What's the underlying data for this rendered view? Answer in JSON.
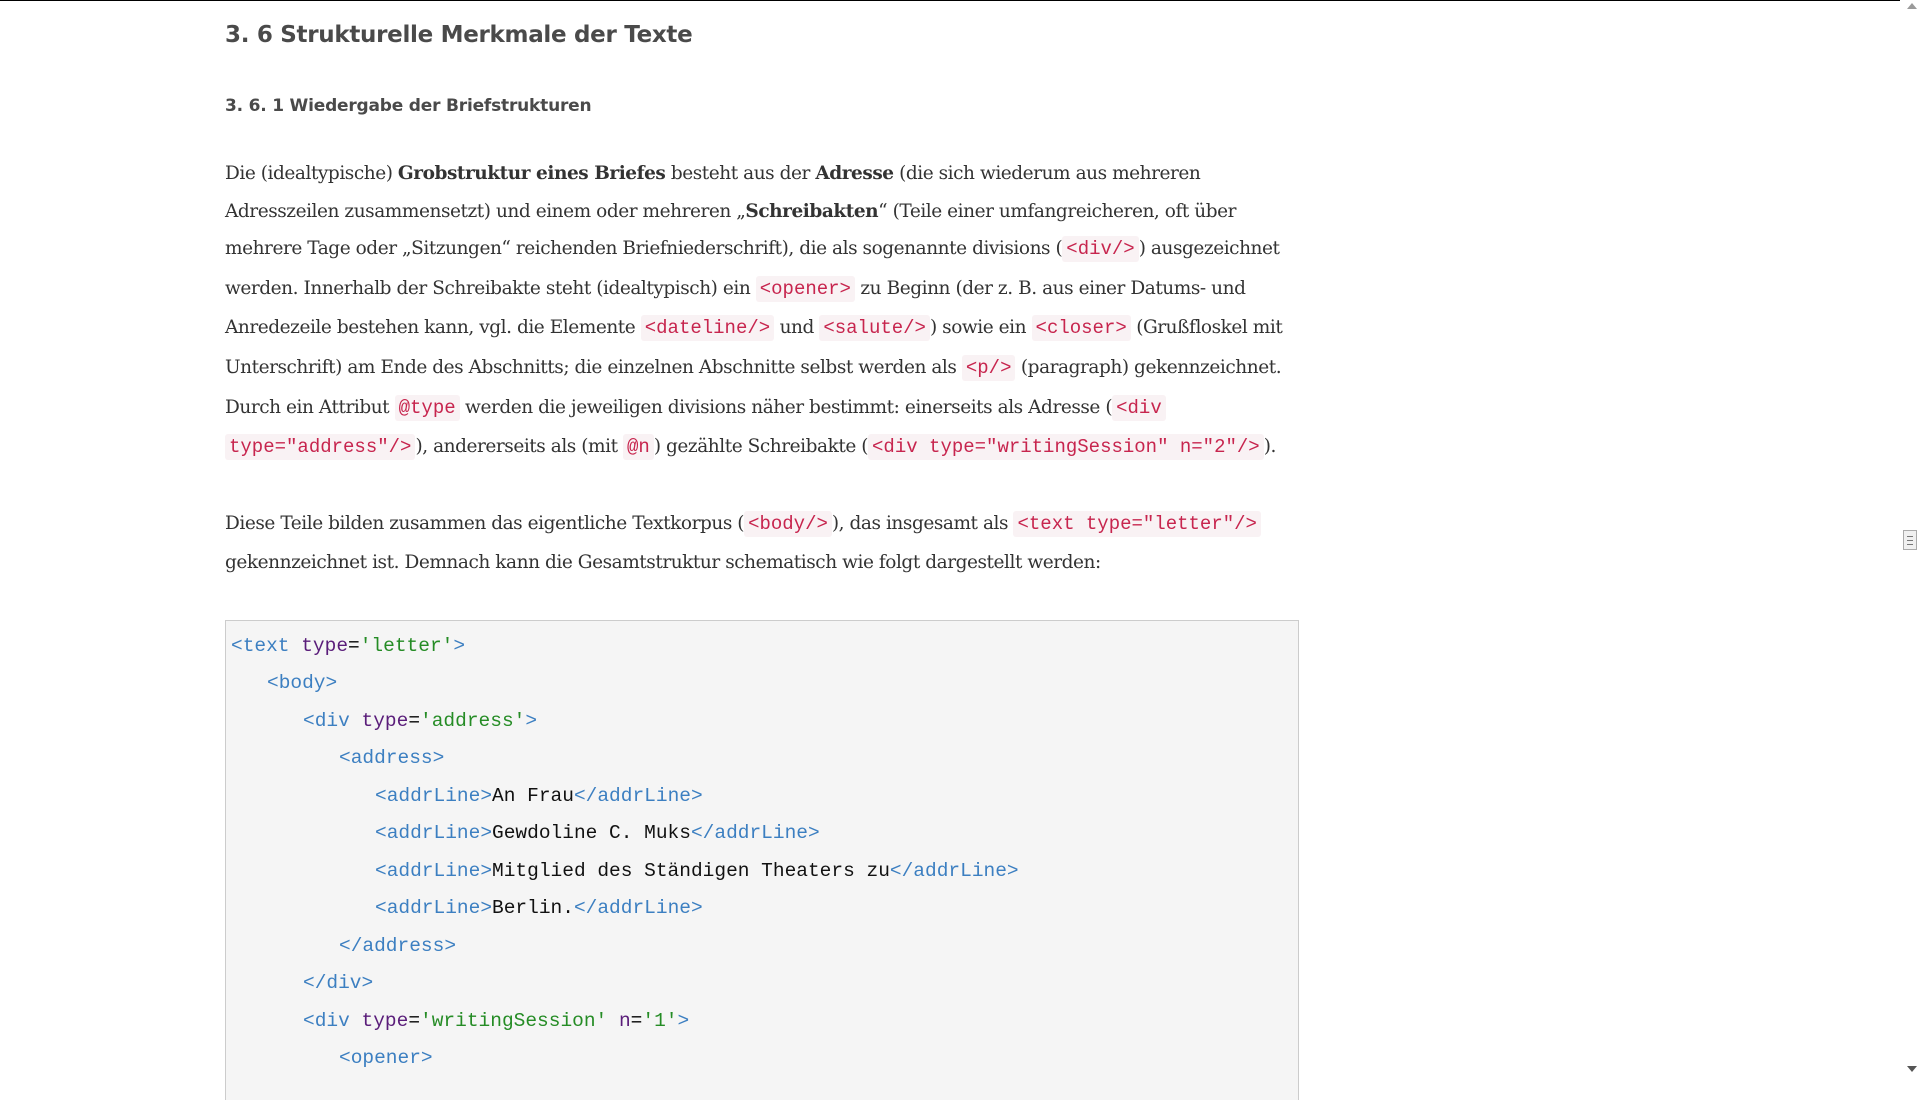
{
  "heading": "3. 6 Strukturelle Merkmale der Texte",
  "subheading": "3. 6. 1 Wiedergabe der Briefstrukturen",
  "paragraph1": {
    "l1": {
      "a": "Die (idealtypische) ",
      "b": "Grobstruktur eines Briefes",
      "c": " besteht aus der ",
      "d": "Adresse",
      "e": " (die sich wiederum aus mehreren"
    },
    "l2": {
      "a": "Adresszeilen zusammensetzt) und einem oder mehreren „",
      "b": "Schreibakten",
      "c": "“ (Teile einer umfangreicheren, oft über"
    },
    "l3": {
      "a": "mehrere Tage oder „Sitzungen“ reichenden Briefniederschrift), die als sogenannte divisions (",
      "c1": "<div/>",
      "b": ") ausgezeichnet"
    },
    "l4": {
      "a": "werden. Innerhalb der Schreibakte steht (idealtypisch) ein ",
      "c1": "<opener>",
      "b": " zu Beginn (der z. B. aus einer Datums- und"
    },
    "l5": {
      "a": "Anredezeile bestehen kann, vgl. die Elemente ",
      "c1": "<dateline/>",
      "b": " und ",
      "c2": "<salute/>",
      "c": ") sowie ein ",
      "c3": "<closer>",
      "d": " (Grußfloskel mit"
    },
    "l6": {
      "a": "Unterschrift) am Ende des Abschnitts; die einzelnen Abschnitte selbst werden als ",
      "c1": "<p/>",
      "b": " (paragraph) gekennzeichnet."
    },
    "l7": {
      "a": "Durch ein Attribut ",
      "c1": "@type",
      "b": " werden die jeweiligen divisions näher bestimmt: einerseits als Adresse (",
      "c2": "<div"
    },
    "l8": {
      "c1": "type=\"address\"/>",
      "a": "), andererseits als (mit ",
      "c2": "@n",
      "b": ") gezählte Schreibakte (",
      "c3": "<div type=\"writingSession\" n=\"2\"/>",
      "c": ")."
    }
  },
  "paragraph2": {
    "l1": {
      "a": "Diese Teile bilden zusammen das eigentliche Textkorpus (",
      "c1": "<body/>",
      "b": "), das insgesamt als ",
      "c2": "<text type=\"letter\"/>"
    },
    "l2": {
      "a": "gekennzeichnet ist. Demnach kann die Gesamtstruktur schematisch wie folgt dargestellt werden:"
    }
  },
  "code": {
    "l1": {
      "t1": "<text",
      "at": "type",
      "eq": "=",
      "v": "'letter'",
      "t2": ">"
    },
    "l2": {
      "t1": "<body>"
    },
    "l3": {
      "t1": "<div",
      "at": "type",
      "eq": "=",
      "v": "'address'",
      "t2": ">"
    },
    "l4": {
      "t1": "<address>"
    },
    "l5": {
      "t1": "<addrLine>",
      "x": "An Frau",
      "t2": "</addrLine>"
    },
    "l6": {
      "t1": "<addrLine>",
      "x": "Gewdoline C. Muks",
      "t2": "</addrLine>"
    },
    "l7": {
      "t1": "<addrLine>",
      "x": "Mitglied des Ständigen Theaters zu",
      "t2": "</addrLine>"
    },
    "l8": {
      "t1": "<addrLine>",
      "x": "Berlin.",
      "t2": "</addrLine>"
    },
    "l9": {
      "t1": "</address>"
    },
    "l10": {
      "t1": "</div>"
    },
    "l11": {
      "t1": "<div",
      "at": "type",
      "eq": "=",
      "v": "'writingSession'",
      "at2": "n",
      "eq2": "=",
      "v2": "'1'",
      "t2": ">"
    },
    "l12": {
      "t1": "<opener>"
    }
  }
}
